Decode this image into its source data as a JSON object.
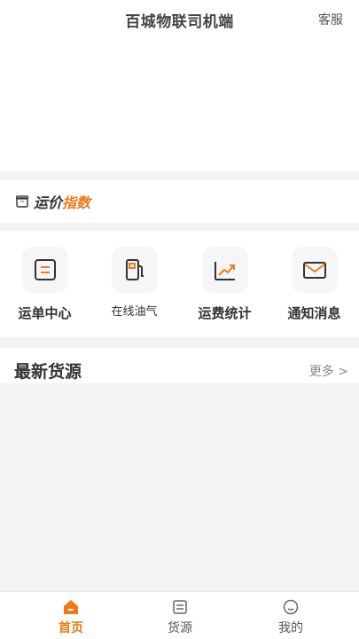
{
  "header": {
    "title": "百城物联司机端",
    "service_label": "客服"
  },
  "index_bar": {
    "text_plain": "运价",
    "text_accent": "指数"
  },
  "menu": [
    {
      "label": "运单中心"
    },
    {
      "label": "在线油气"
    },
    {
      "label": "运费统计"
    },
    {
      "label": "通知消息"
    }
  ],
  "latest": {
    "title": "最新货源",
    "more_label": "更多 >"
  },
  "tabs": [
    {
      "label": "首页",
      "active": true
    },
    {
      "label": "货源",
      "active": false
    },
    {
      "label": "我的",
      "active": false
    }
  ],
  "colors": {
    "accent": "#f07a16",
    "text": "#333333",
    "muted": "#888888"
  }
}
